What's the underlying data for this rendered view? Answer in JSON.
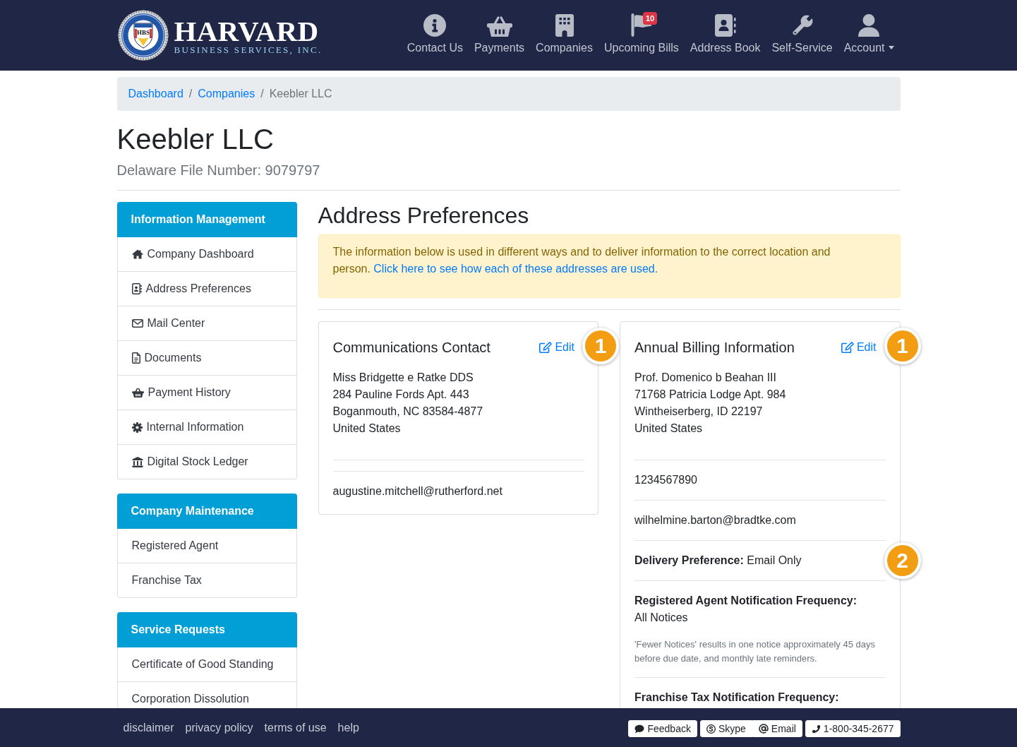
{
  "header": {
    "logo": {
      "seal_text": "HBS",
      "name": "HARVARD",
      "tagline": "BUSINESS SERVICES, INC."
    },
    "nav": [
      {
        "kind": "info",
        "label": "Contact Us",
        "dropdown": false
      },
      {
        "kind": "basket",
        "label": "Payments",
        "dropdown": false
      },
      {
        "kind": "building",
        "label": "Companies",
        "dropdown": false
      },
      {
        "kind": "flag",
        "label": "Upcoming Bills",
        "badge": "10",
        "dropdown": false
      },
      {
        "kind": "address_book",
        "label": "Address Book",
        "dropdown": false
      },
      {
        "kind": "wrench",
        "label": "Self-Service",
        "dropdown": false
      },
      {
        "kind": "user",
        "label": "Account",
        "dropdown": true
      }
    ]
  },
  "breadcrumb": [
    {
      "kind": "link",
      "label": "Dashboard"
    },
    {
      "kind": "separator",
      "label": "/"
    },
    {
      "kind": "link",
      "label": "Companies"
    },
    {
      "kind": "separator",
      "label": "/"
    },
    {
      "kind": "current",
      "label": "Keebler LLC"
    }
  ],
  "company": {
    "name": "Keebler LLC",
    "file_number": "Delaware File Number: 9079797"
  },
  "sidebar": [
    {
      "title": "Information Management",
      "items": [
        {
          "kind": "home",
          "label": "Company Dashboard"
        },
        {
          "kind": "contact",
          "label": "Address Preferences"
        },
        {
          "kind": "envelope",
          "label": "Mail Center"
        },
        {
          "kind": "file",
          "label": "Documents"
        },
        {
          "kind": "basket",
          "label": "Payment History"
        },
        {
          "kind": "gear",
          "label": "Internal Information"
        },
        {
          "kind": "bank",
          "label": "Digital Stock Ledger"
        }
      ]
    },
    {
      "title": "Company Maintenance",
      "items": [
        {
          "kind": "plain",
          "label": "Registered Agent"
        },
        {
          "kind": "plain",
          "label": "Franchise Tax"
        }
      ]
    },
    {
      "title": "Service Requests",
      "items": [
        {
          "kind": "plain",
          "label": "Certificate of Good Standing"
        },
        {
          "kind": "plain",
          "label": "Corporation Dissolution"
        }
      ]
    }
  ],
  "main": {
    "title": "Address Preferences",
    "notice": {
      "text": "The information below is used in different ways and to deliver information to the correct location and person.",
      "link": "Click here to see how each of these addresses are used."
    },
    "cards": [
      {
        "title": "Communications Contact",
        "edit": "Edit",
        "marker": "1",
        "sections": [
          {
            "kind": "address",
            "lines": [
              "Miss Bridgette e Ratke DDS",
              "284 Pauline Fords Apt. 443",
              "Boganmouth, NC 83584-4877",
              "United States"
            ]
          },
          {
            "kind": "empty"
          },
          {
            "kind": "email",
            "text": "augustine.mitchell@rutherford.net"
          }
        ]
      },
      {
        "title": "Annual Billing Information",
        "edit": "Edit",
        "marker": "1",
        "sections": [
          {
            "kind": "address",
            "lines": [
              "Prof. Domenico b Beahan III",
              "71768 Patricia Lodge Apt. 984",
              "Wintheiserberg, ID 22197",
              "United States"
            ]
          },
          {
            "kind": "phone",
            "text": "1234567890"
          },
          {
            "kind": "email",
            "text": "wilhelmine.barton@bradtke.com"
          },
          {
            "kind": "inline_field",
            "label": "Delivery Preference:",
            "value": "Email Only",
            "marker": "2"
          },
          {
            "kind": "block_field",
            "label": "Registered Agent Notification Frequency:",
            "value": "All Notices",
            "note": "'Fewer Notices' results in one notice approximately 45 days before due date, and monthly late reminders."
          },
          {
            "kind": "block_field",
            "label": "Franchise Tax Notification Frequency:"
          }
        ]
      }
    ]
  },
  "footer": {
    "links": [
      "disclaimer",
      "privacy policy",
      "terms of use",
      "help"
    ],
    "button_groups": [
      {
        "buttons": [
          {
            "kind": "comment",
            "label": "Feedback"
          }
        ]
      },
      {
        "buttons": [
          {
            "kind": "skype",
            "label": "Skype"
          },
          {
            "kind": "at",
            "label": "Email"
          }
        ]
      },
      {
        "buttons": [
          {
            "kind": "phone",
            "label": "1-800-345-2677"
          }
        ]
      }
    ]
  }
}
